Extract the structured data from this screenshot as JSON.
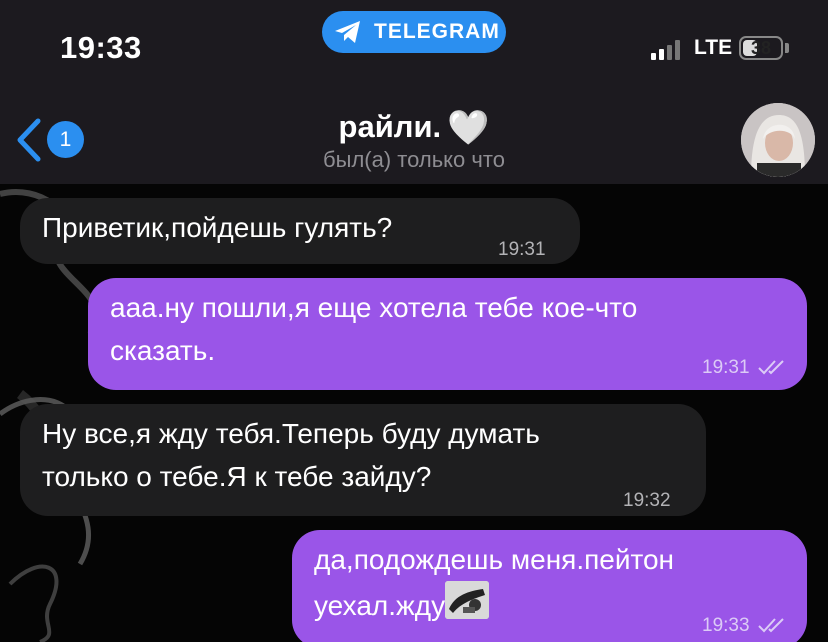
{
  "status_bar": {
    "time": "19:33",
    "app_pill": "TELEGRAM",
    "network": "LTE",
    "battery": "38",
    "battery_level": 0.38
  },
  "header": {
    "back_badge": "1",
    "title": "райли.",
    "title_emoji": "🤍",
    "status": "был(а) только что"
  },
  "messages": [
    {
      "direction": "in",
      "text": "Приветик,пойдешь гулять?",
      "time": "19:31"
    },
    {
      "direction": "out",
      "line1": "ааа.ну пошли,я еще хотела тебе кое-что",
      "line2": "сказать.",
      "time": "19:31",
      "read": true
    },
    {
      "direction": "in",
      "line1": "Ну все,я жду тебя.Теперь буду думать",
      "line2": "только о тебе.Я к тебе зайду?",
      "time": "19:32"
    },
    {
      "direction": "out",
      "line1": "да,подождешь меня.пейтон",
      "line2": "уехал.жду",
      "time": "19:33",
      "read": true
    }
  ],
  "colors": {
    "header_bg": "#1c1a1f",
    "accent": "#2b8ff0",
    "outgoing_bubble": "#9a55e8",
    "incoming_bubble": "#1e1e1f"
  },
  "icons": [
    "telegram-icon",
    "signal-icon",
    "battery-icon",
    "back-chevron-icon",
    "avatar",
    "read-checkmarks-icon",
    "sticker-icon"
  ]
}
